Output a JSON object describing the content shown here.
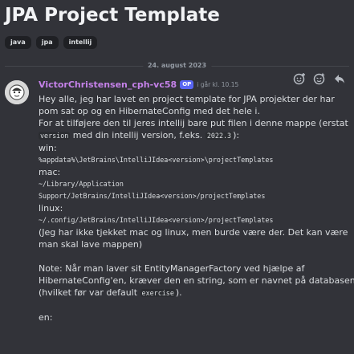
{
  "thread": {
    "title": "JPA Project Template",
    "tags": [
      "java",
      "jpa",
      "intellij"
    ]
  },
  "date_divider": "24. august 2023",
  "message": {
    "author": "VictorChristensen_cph-vc58",
    "author_color": "#c481e8",
    "badge": "OP",
    "timestamp": "i går kl. 10.15",
    "lines": {
      "l1": "Hey alle, jeg har lavet en project template for JPA projekter der har",
      "l2": "pom sat op og en HibernateConfig med det hele i.",
      "l3": "For at tilføjere den til jeres intellij bare put filen i denne mappe (erstat",
      "l4a": "version",
      "l4b": " med din intellij version, f.eks. ",
      "l4c": "2022.3",
      "l4d": "):",
      "l5": "win:",
      "l6": "%appdata%\\JetBrains\\IntelliJIdea<version>\\projectTemplates",
      "l7": "mac:",
      "l8": "~/Library/Application",
      "l9": "Support/JetBrains/IntelliJIdea<version>/projectTemplates",
      "l10": "linux:",
      "l11": "~/.config/JetBrains/IntelliJIdea<version>/projectTemplates",
      "l12": "(Jeg har ikke tjekket mac og linux, men burde være der. Det kan være",
      "l13": "man skal lave mappen)",
      "l14": "Note: Når man laver sit EntityManagerFactory ved hjælpe af",
      "l15": "HibernateConfig'en, kræver den en string, som er navnet på databasen",
      "l16a": "(hvilket før var default ",
      "l16b": "exercise",
      "l16c": ").",
      "l17": "en:"
    }
  },
  "icons": {
    "reaction": "add-reaction-icon",
    "super_reaction": "super-reaction-icon",
    "reply": "reply-icon"
  }
}
